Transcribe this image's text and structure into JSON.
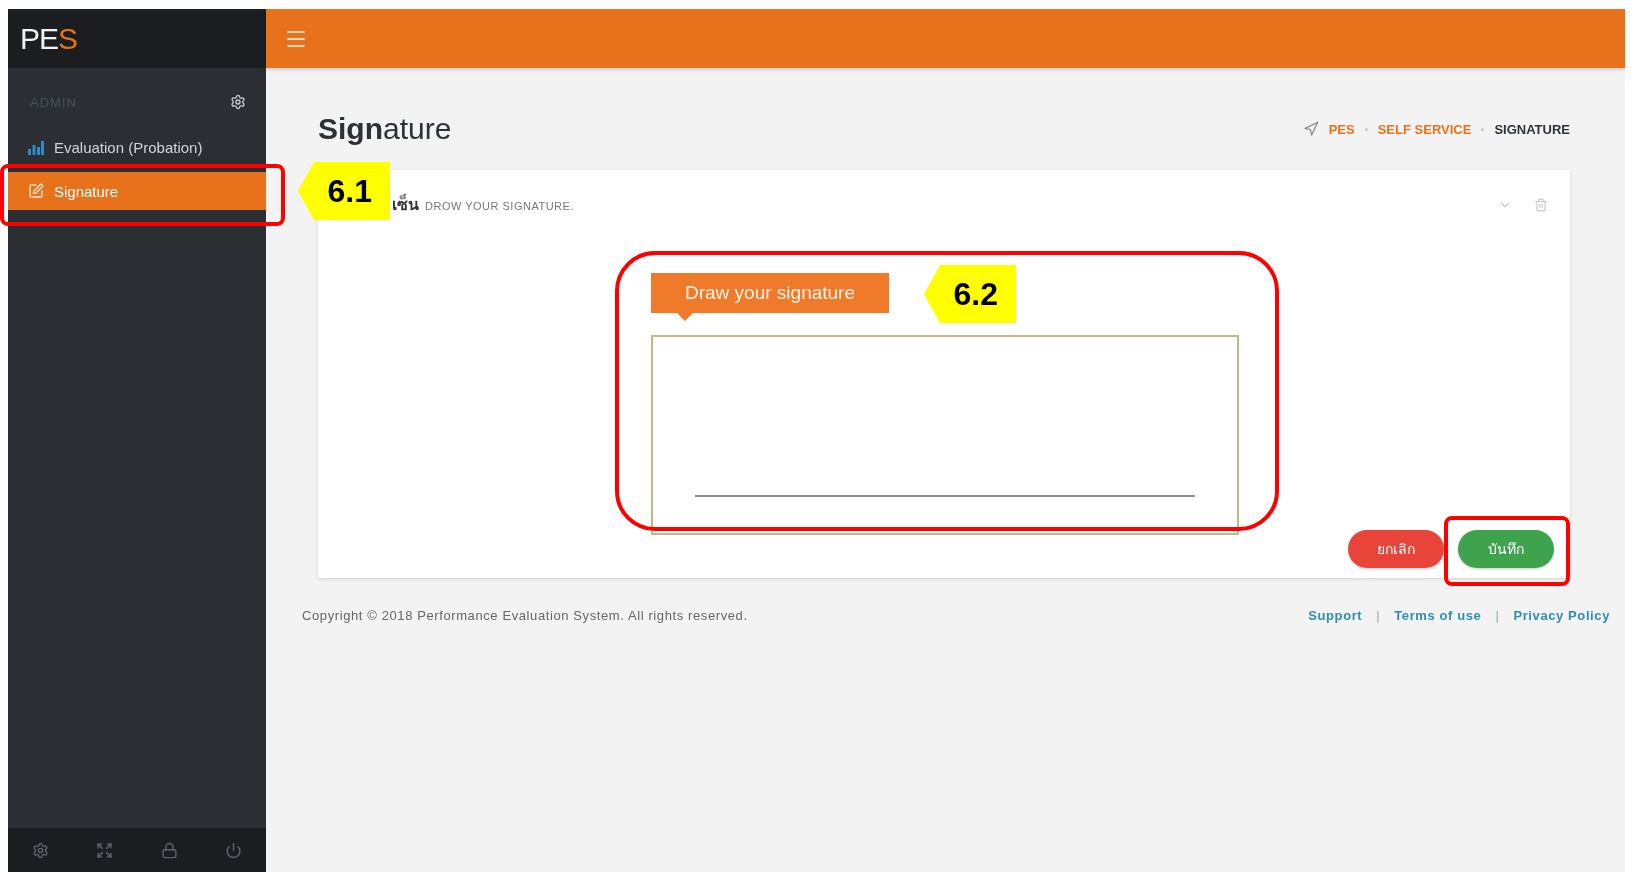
{
  "logo": {
    "text": "PE",
    "accent": "S"
  },
  "sidebar": {
    "section": "ADMIN",
    "items": [
      {
        "label": "Evaluation (Probation)",
        "selected": false
      },
      {
        "label": "Signature",
        "selected": true,
        "annotation": "6.1"
      }
    ]
  },
  "page": {
    "title": "**Sign**ature",
    "breadcrumb": [
      {
        "label": "PES",
        "current": false
      },
      {
        "label": "SELF SERVICE",
        "current": false
      },
      {
        "label": "SIGNATURE",
        "current": true
      }
    ]
  },
  "card": {
    "title": "เซ็น",
    "subtitle": "DROW YOUR SIGNATURE.",
    "pad": {
      "tag": "Draw your signature",
      "annotation": "6.2"
    },
    "buttons": [
      {
        "label": "ยกเลิก",
        "kind": "cancel",
        "highlighted": false
      },
      {
        "label": "บันทึก",
        "kind": "save",
        "highlighted": true
      }
    ]
  },
  "footer": {
    "copyright": "Copyright © 2018 Performance Evaluation System. All rights reserved.",
    "separator": "|",
    "links": [
      "Support",
      "Terms of use",
      "Privacy Policy"
    ]
  }
}
